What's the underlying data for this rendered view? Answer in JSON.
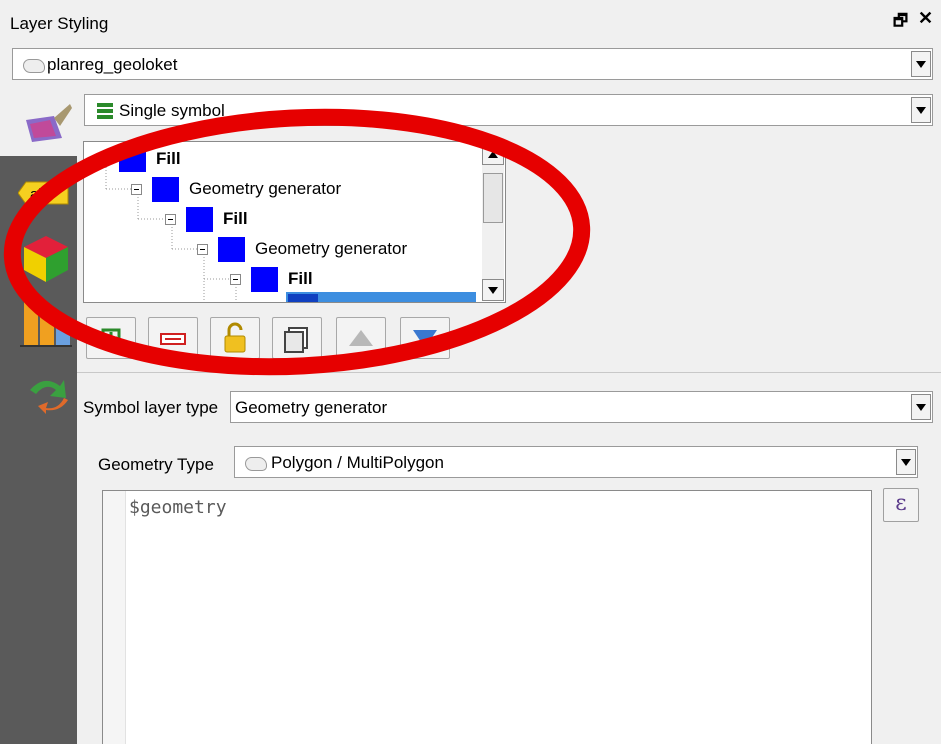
{
  "panel": {
    "title": "Layer Styling",
    "float_icon": "🗗",
    "close_icon": "✕"
  },
  "layer_select": {
    "value": "planreg_geoloket"
  },
  "renderer_select": {
    "value": "Single symbol"
  },
  "sidebar": {
    "icons": [
      "symbology-paintbrush-icon",
      "labels-abc-icon",
      "3d-cube-icon",
      "diagram-icon",
      "history-undo-icon"
    ],
    "abc_text": "abc"
  },
  "symbol_tree": {
    "rows": [
      {
        "label": "Fill",
        "bold": true
      },
      {
        "label": "Geometry generator",
        "bold": false
      },
      {
        "label": "Fill",
        "bold": true
      },
      {
        "label": "Geometry generator",
        "bold": false
      },
      {
        "label": "Fill",
        "bold": true
      }
    ]
  },
  "tree_toolbar": {
    "buttons": [
      "add-layer-icon",
      "remove-layer-icon",
      "lock-icon",
      "duplicate-icon",
      "move-up-icon",
      "move-down-icon"
    ]
  },
  "symbol_layer_type": {
    "label": "Symbol layer type",
    "value": "Geometry generator"
  },
  "geometry_type": {
    "label": "Geometry Type",
    "value": "Polygon / MultiPolygon"
  },
  "expression": {
    "text": "$geometry",
    "button_symbol": "ε"
  },
  "colors": {
    "annotation_red": "#e60000",
    "swatch_blue": "#0000ff",
    "sidebar_bg": "#5a5a5a"
  }
}
